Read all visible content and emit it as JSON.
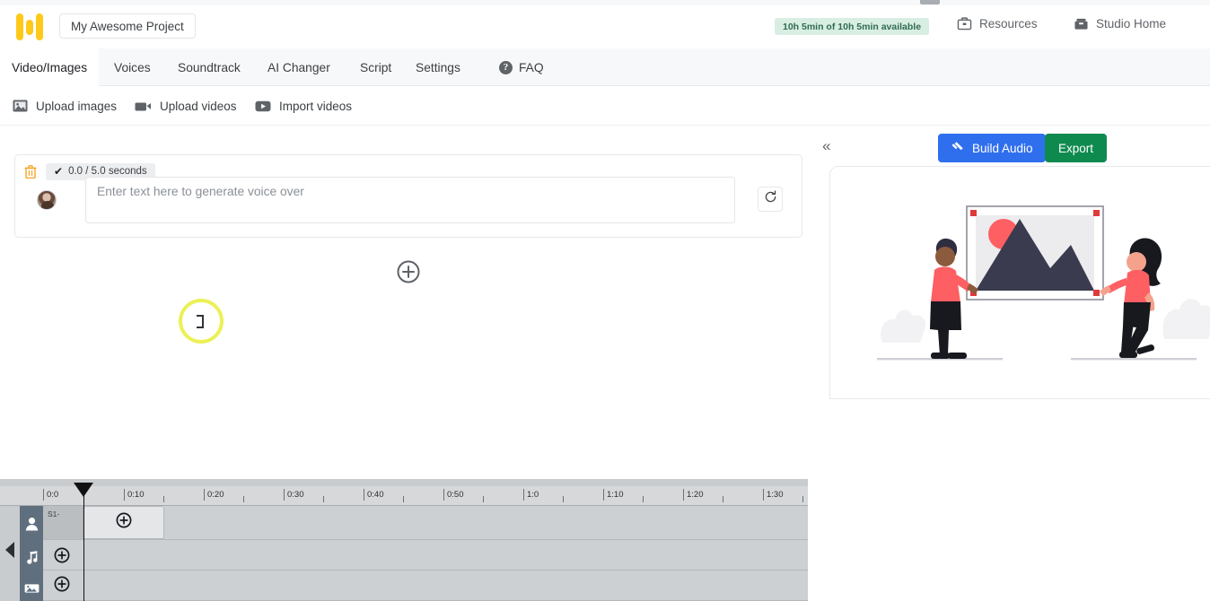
{
  "header": {
    "logo_name": "app-logo",
    "project_name": "My Awesome Project",
    "quota_badge": "10h 5min of 10h 5min available",
    "resources_label": "Resources",
    "studio_home_label": "Studio Home"
  },
  "tabs": [
    {
      "label": "Video/Images",
      "active": true
    },
    {
      "label": "Voices",
      "active": false
    },
    {
      "label": "Soundtrack",
      "active": false
    },
    {
      "label": "AI Changer",
      "active": false
    },
    {
      "label": "Script",
      "active": false
    },
    {
      "label": "Settings",
      "active": false
    },
    {
      "label": "FAQ",
      "active": false,
      "icon": "question-circle-icon"
    }
  ],
  "subtoolbar": [
    {
      "label": "Upload images",
      "icon": "image-icon"
    },
    {
      "label": "Upload videos",
      "icon": "video-camera-icon"
    },
    {
      "label": "Import videos",
      "icon": "youtube-icon"
    }
  ],
  "scene": {
    "delete_icon": "trash-icon",
    "check_mark": "✔",
    "duration_label": "0.0 / 5.0 seconds",
    "avatar_name": "voice-avatar",
    "textarea_value": "",
    "textarea_placeholder": "Enter text here to generate voice over",
    "regenerate_icon": "refresh-icon"
  },
  "add_scene_label": "add-scene-button",
  "preview": {
    "collapse_label": "«",
    "build_audio_label": "Build Audio",
    "build_audio_color": "#2f6fed",
    "export_label": "Export",
    "export_color": "#0f8a4f",
    "illustration": "two-people-hanging-picture-frame"
  },
  "timeline": {
    "ruler_labels": [
      "0:0",
      "0:10",
      "0:20",
      "0:30",
      "0:40",
      "0:50",
      "1:0",
      "1:10",
      "1:20",
      "1:30"
    ],
    "playhead_position": "0:0",
    "tracks": [
      {
        "name": "voice-track",
        "icon": "person-icon",
        "clip_label": "S1-",
        "has_clip": true
      },
      {
        "name": "music-track",
        "icon": "music-note-icon",
        "clip_label": "",
        "has_clip": false
      },
      {
        "name": "media-track",
        "icon": "film-icon",
        "clip_label": "",
        "has_clip": false
      }
    ]
  }
}
